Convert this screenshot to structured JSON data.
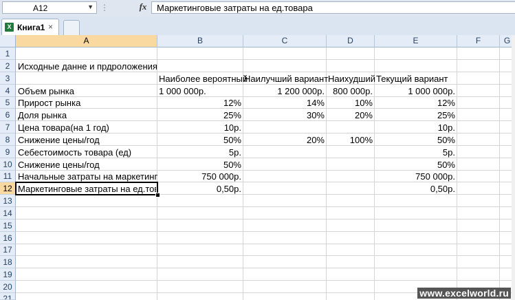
{
  "formula_bar": {
    "name_box": "A12",
    "fx_label": "fx",
    "content": "Маркетинговые затраты на ед.товара"
  },
  "tabs": [
    {
      "label": "Книга1",
      "close": "×"
    }
  ],
  "columns": [
    "A",
    "B",
    "C",
    "D",
    "E",
    "F",
    "G"
  ],
  "rows": [
    "1",
    "2",
    "3",
    "4",
    "5",
    "6",
    "7",
    "8",
    "9",
    "10",
    "11",
    "12",
    "13",
    "14",
    "15",
    "16",
    "17",
    "18",
    "19",
    "20",
    "21"
  ],
  "cells": {
    "r2": {
      "a": "Исходные данне и прдроложения"
    },
    "r3": {
      "b": "Наиболее вероятный",
      "c": "Наилучший вариант",
      "d": "Наихудший",
      "e": "Текущий вариант"
    },
    "r4": {
      "a": "Объем рынка",
      "b": "1 000  000р.",
      "c": "1 200 000р.",
      "d": "800 000р.",
      "e": "1 000 000р."
    },
    "r5": {
      "a": "Прирост рынка",
      "b": "12%",
      "c": "14%",
      "d": "10%",
      "e": "12%"
    },
    "r6": {
      "a": "Доля рынка",
      "b": "25%",
      "c": "30%",
      "d": "20%",
      "e": "25%"
    },
    "r7": {
      "a": "Цена товара(на 1 год)",
      "b": "10р.",
      "e": "10р."
    },
    "r8": {
      "a": "Снижение цены/год",
      "b": "50%",
      "c": "20%",
      "d": "100%",
      "e": "50%"
    },
    "r9": {
      "a": "Себестоимость товара (ед)",
      "b": "5р.",
      "e": "5р."
    },
    "r10": {
      "a": "Снижение цены/год",
      "b": "50%",
      "e": "50%"
    },
    "r11": {
      "a": "Начальные затраты на маркетинг",
      "b": "750 000р.",
      "e": "750 000р."
    },
    "r12": {
      "a": "Маркетинговые затраты на ед.товара",
      "b": "0,50р.",
      "e": "0,50р."
    }
  },
  "watermark": "www.excelworld.ru",
  "colors": {
    "selected_header": "#f9d99f",
    "header_bg": "#e4ecf7",
    "excel_icon": "#1f7a3c"
  }
}
